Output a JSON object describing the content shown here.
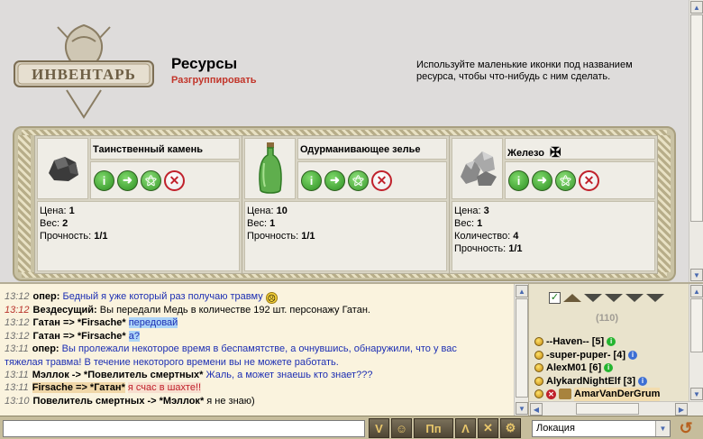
{
  "inventory": {
    "logo_text": "ИНВЕНТАРЬ",
    "title": "Ресурсы",
    "ungroup_link": "Разгруппировать",
    "hint": "Используйте маленькие иконки под названием ресурса, чтобы что-нибудь с ним сделать.",
    "items": [
      {
        "name": "Таинственный камень",
        "icon": "stone-icon",
        "props": [
          {
            "label": "Цена:",
            "value": "1"
          },
          {
            "label": "Вес:",
            "value": "2"
          },
          {
            "label": "Прочность:",
            "value": "1/1"
          }
        ]
      },
      {
        "name": "Одурманивающее зелье",
        "icon": "green-potion-icon",
        "props": [
          {
            "label": "Цена:",
            "value": "10"
          },
          {
            "label": "Вес:",
            "value": "1"
          },
          {
            "label": "Прочность:",
            "value": "1/1"
          }
        ]
      },
      {
        "name": "Железо",
        "icon": "iron-ore-icon",
        "props": [
          {
            "label": "Цена:",
            "value": "3"
          },
          {
            "label": "Вес:",
            "value": "1"
          },
          {
            "label": "Количество:",
            "value": "4"
          },
          {
            "label": "Прочность:",
            "value": "1/1"
          }
        ]
      }
    ],
    "actions": [
      "info-icon",
      "use-icon",
      "send-icon",
      "delete-icon"
    ]
  },
  "chat": {
    "lines": [
      {
        "time": "13:12",
        "time_red": false,
        "nick": "oпер:",
        "text": "Бедный я  уже который раз получаю травму",
        "style": "blue"
      },
      {
        "time": "13:12",
        "time_red": true,
        "nick": "Вездесущий:",
        "text": "Вы передали Медь в количестве 192 шт. персонажу Гатан.",
        "style": "system"
      },
      {
        "time": "13:12",
        "time_red": false,
        "nick": "Гатан => *Firsache*",
        "text": "передовай",
        "style": "hl"
      },
      {
        "time": "13:12",
        "time_red": false,
        "nick": "Гатан => *Firsache*",
        "text": "а?",
        "style": "hl"
      },
      {
        "time": "13:11",
        "time_red": false,
        "nick": "oпер:",
        "text": "Вы пролежали некоторое время в беспамятстве, а очнувшись, обнаружили, что у вас",
        "style": "blue"
      },
      {
        "time": "",
        "time_red": false,
        "nick": "",
        "text": "тяжелая травма! В течение некоторого времени вы не можете работать.",
        "style": "blue"
      },
      {
        "time": "13:11",
        "time_red": false,
        "nick": "Мэллок -> *Повелитель смертных*",
        "text": "Жаль, а может знаешь кто знает???",
        "style": "blue"
      },
      {
        "time": "13:11",
        "time_red": false,
        "nick": "Firsache => *Гатан*",
        "text": "я счас в шахте!!",
        "style": "red"
      },
      {
        "time": "13:10",
        "time_red": false,
        "nick": "Повелитель смертных -> *Мэллок*",
        "text": "я не знаю)",
        "style": "plain"
      }
    ]
  },
  "users": {
    "count": "(110)",
    "list": [
      {
        "name": "--Haven-- [5]",
        "badge": "online"
      },
      {
        "name": "-super-puper- [4]",
        "badge": "info"
      },
      {
        "name": "AlexM01 [6]",
        "badge": "online"
      },
      {
        "name": "AlykardNightElf [3]",
        "badge": "info"
      },
      {
        "name": "AmarVanDerGrum",
        "badge": "ban"
      }
    ]
  },
  "bottom": {
    "chat_input_value": "",
    "location": "Локация",
    "tool_buttons": [
      "V",
      "☺",
      "Пп",
      "Λ",
      "✕",
      "⚙"
    ]
  }
}
